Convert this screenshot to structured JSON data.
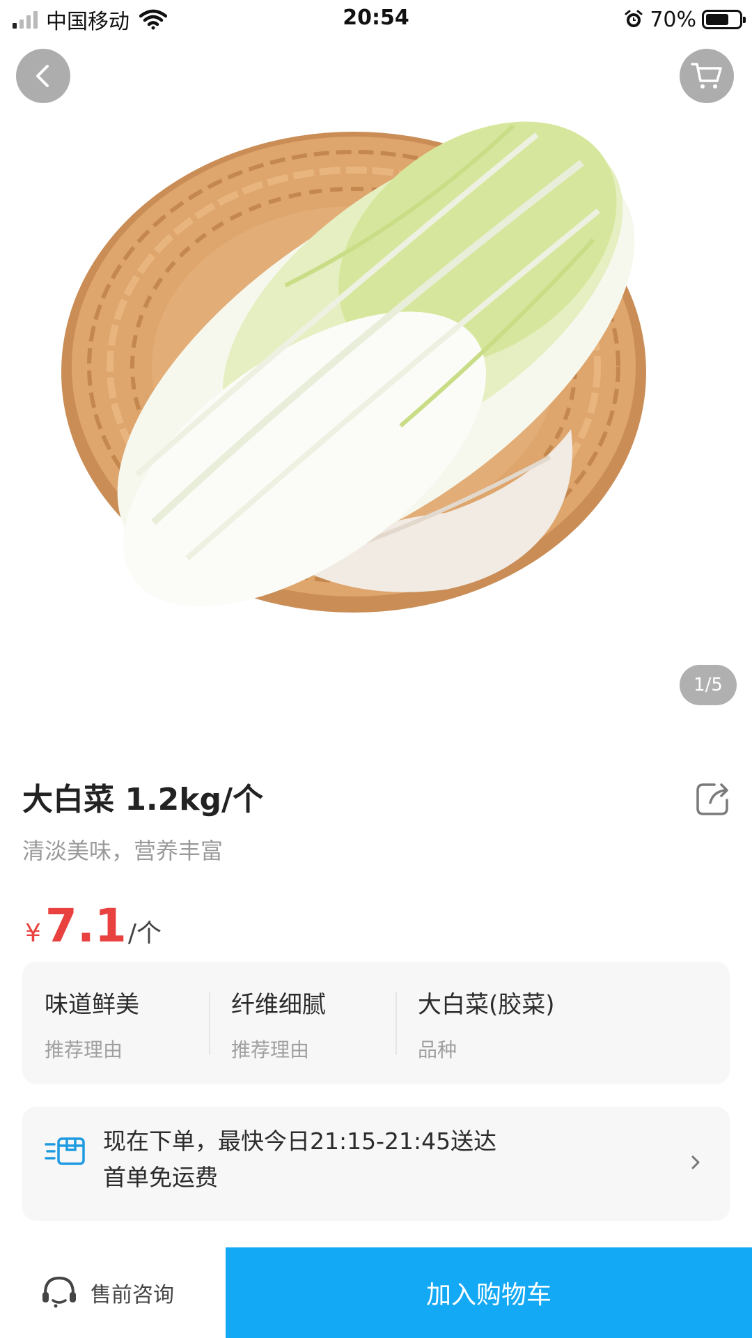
{
  "status_bar": {
    "carrier": "中国移动",
    "time": "20:54",
    "battery_percent": "70%",
    "battery_level": 0.7,
    "icons": [
      "signal-icon",
      "wifi-icon",
      "alarm-icon",
      "battery-icon"
    ]
  },
  "hero": {
    "page_indicator": "1/5",
    "image_subject": "napa-cabbage-in-basket",
    "icons": [
      "back-icon",
      "cart-icon"
    ]
  },
  "product": {
    "title": "大白菜 1.2kg/个",
    "subtitle": "清淡美味，营养丰富",
    "price_currency": "¥",
    "price_value": "7.1",
    "price_unit": "/个",
    "price_color": "#e8413f"
  },
  "attributes": [
    {
      "value": "味道鲜美",
      "label": "推荐理由"
    },
    {
      "value": "纤维细腻",
      "label": "推荐理由"
    },
    {
      "value": "大白菜(胶菜)",
      "label": "品种"
    }
  ],
  "delivery": {
    "line1": "现在下单，最快今日21:15-21:45送达",
    "line2": "首单免运费",
    "icon": "delivery-box-icon",
    "accent": "#1e9be0"
  },
  "bottom_bar": {
    "consult_label": "售前咨询",
    "add_to_cart_label": "加入购物车",
    "button_color": "#14a9f4",
    "icons": [
      "headset-icon"
    ]
  }
}
